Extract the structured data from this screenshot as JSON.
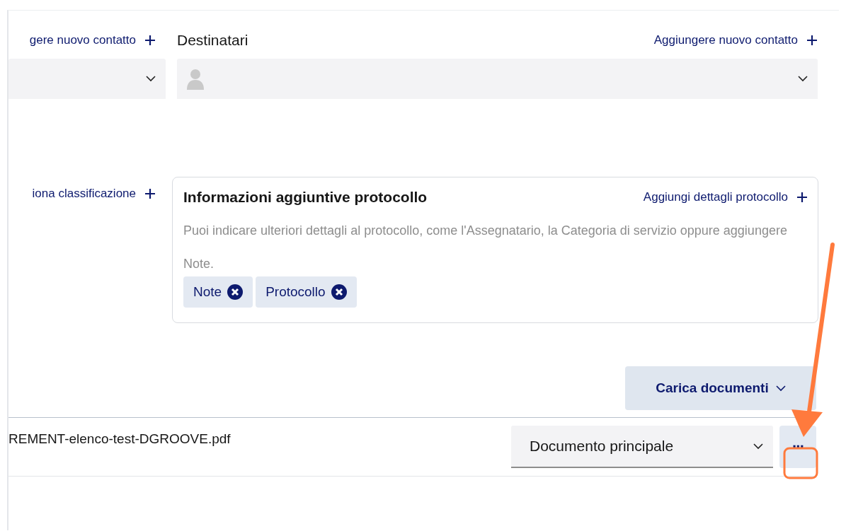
{
  "senders": {
    "add_link": "gere nuovo contatto"
  },
  "recipients": {
    "label": "Destinatari",
    "add_link": "Aggiungere nuovo contatto"
  },
  "classification": {
    "add_link": "iona classificazione"
  },
  "protocol_info": {
    "title": "Informazioni aggiuntive protocollo",
    "add_link": "Aggiungi dettagli protocollo",
    "description": "Puoi indicare ulteriori dettagli al protocollo, come l'Assegnatario, la Categoria di servizio oppure aggiungere Note.",
    "chips": [
      {
        "label": "Note"
      },
      {
        "label": "Protocollo"
      }
    ]
  },
  "upload_button": {
    "label": "Carica documenti"
  },
  "documents": [
    {
      "file_name": "REMENT-elenco-test-DGROOVE.pdf",
      "type": "Documento principale",
      "more": "···"
    }
  ]
}
